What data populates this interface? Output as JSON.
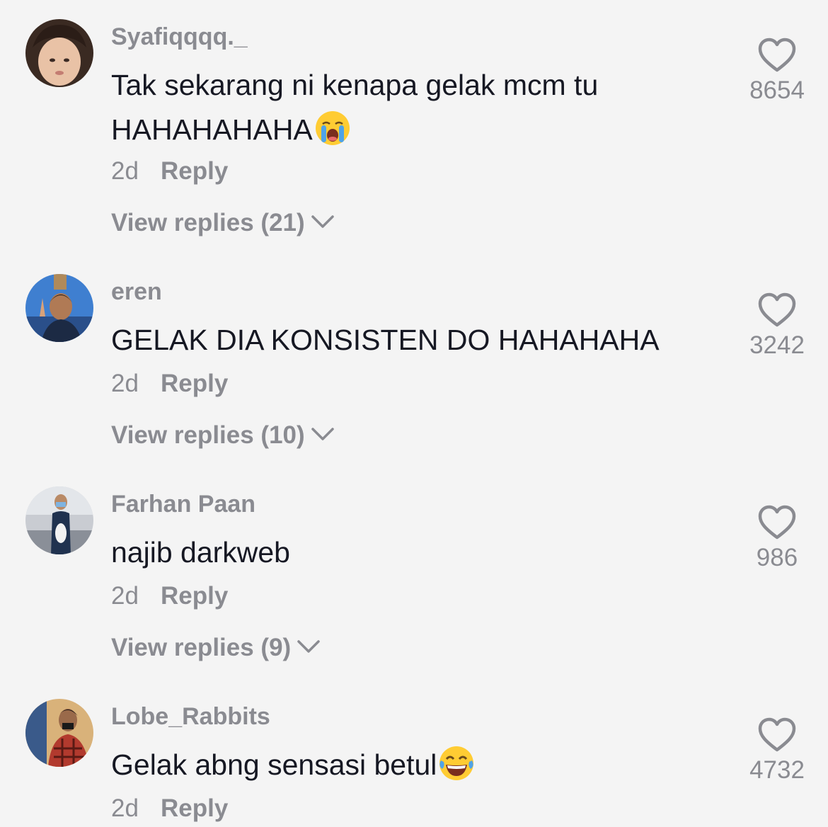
{
  "comments": [
    {
      "username": "Syafiqqqq._",
      "text": "Tak sekarang ni kenapa gelak mcm tu HAHAHAHAHA",
      "emoji": "loudly-crying-face",
      "time": "2d",
      "reply_label": "Reply",
      "view_replies": "View replies (21)",
      "likes": "8654"
    },
    {
      "username": "eren",
      "text": "GELAK DIA KONSISTEN DO HAHAHAHA",
      "time": "2d",
      "reply_label": "Reply",
      "view_replies": "View replies (10)",
      "likes": "3242"
    },
    {
      "username": "Farhan Paan",
      "text": "najib darkweb",
      "time": "2d",
      "reply_label": "Reply",
      "view_replies": "View replies (9)",
      "likes": "986"
    },
    {
      "username": "Lobe_Rabbits",
      "text": "Gelak abng sensasi betul",
      "emoji": "face-with-tears-of-joy",
      "time": "2d",
      "reply_label": "Reply",
      "likes": "4732"
    }
  ],
  "icons": {
    "like": "heart-outline-icon",
    "expand": "chevron-down-icon"
  },
  "colors": {
    "background": "#f4f4f4",
    "primary_text": "#161823",
    "secondary_text": "#8a8b91"
  }
}
